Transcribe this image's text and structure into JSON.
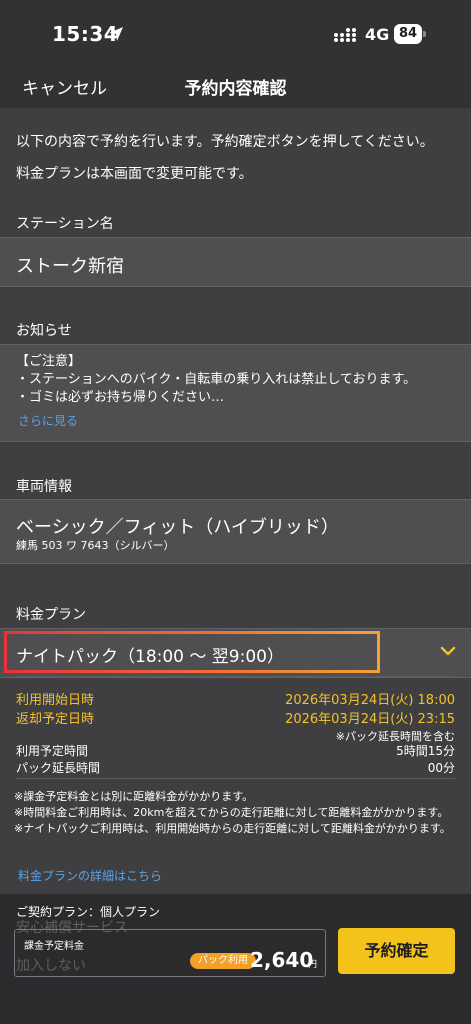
{
  "status_bar": {
    "time": "15:34",
    "network": "4G",
    "battery": "84"
  },
  "nav": {
    "cancel_label": "キャンセル",
    "title": "予約内容確認"
  },
  "intro": {
    "line1": "以下の内容で予約を行います。予約確定ボタンを押してください。",
    "line2": "料金プランは本画面で変更可能です。"
  },
  "station": {
    "label": "ステーション名",
    "name": "ストーク新宿"
  },
  "notice": {
    "label": "お知らせ",
    "heading": "【ご注意】",
    "line1": "・ステーションへのバイク・自転車の乗り入れは禁止しております。",
    "line2": "・ゴミは必ずお持ち帰りください…",
    "more_link": "さらに見る"
  },
  "vehicle": {
    "label": "車両情報",
    "name": "ベーシック／フィット（ハイブリッド）",
    "plate": "練馬 503 ワ 7643（シルバー）"
  },
  "plan": {
    "label": "料金プラン",
    "selected": "ナイトパック（18:00 〜 翌9:00）",
    "start_label": "利用開始日時",
    "start_value": "2026年03月24日(火) 18:00",
    "return_label": "返却予定日時",
    "return_value": "2026年03月24日(火) 23:15",
    "extension_note": "※パック延長時間を含む",
    "usage_label": "利用予定時間",
    "usage_value": "5時間15分",
    "extension_label": "パック延長時間",
    "extension_value": "00分"
  },
  "notes": {
    "line1": "※課金予定料金とは別に距離料金がかかります。",
    "line2": "※時間料金ご利用時は、20kmを超えてからの走行距離に対して距離料金がかかります。",
    "line3": "※ナイトパックご利用時は、利用開始時からの走行距離に対して距離料金がかかります。",
    "detail_link": "料金プランの詳細はこちら"
  },
  "footer": {
    "contract_plan": "ご契約プラン：個人プラン",
    "ghost_text_1": "安心補償サービス",
    "ghost_text_2": "加入しない",
    "fee_label": "課金予定料金",
    "pack_badge": "パック利用",
    "fee_amount": "2,640",
    "fee_unit": "円",
    "confirm_label": "予約確定"
  },
  "colors": {
    "accent_yellow": "#f3c22b",
    "link_blue": "#5ba2e6",
    "badge_orange": "#f3a026",
    "highlight_gradient_start": "#e8333a",
    "highlight_gradient_end": "#f5a035"
  },
  "icons": [
    "location-arrow-icon",
    "cellular-signal-icon",
    "battery-icon",
    "chevron-down-icon"
  ]
}
